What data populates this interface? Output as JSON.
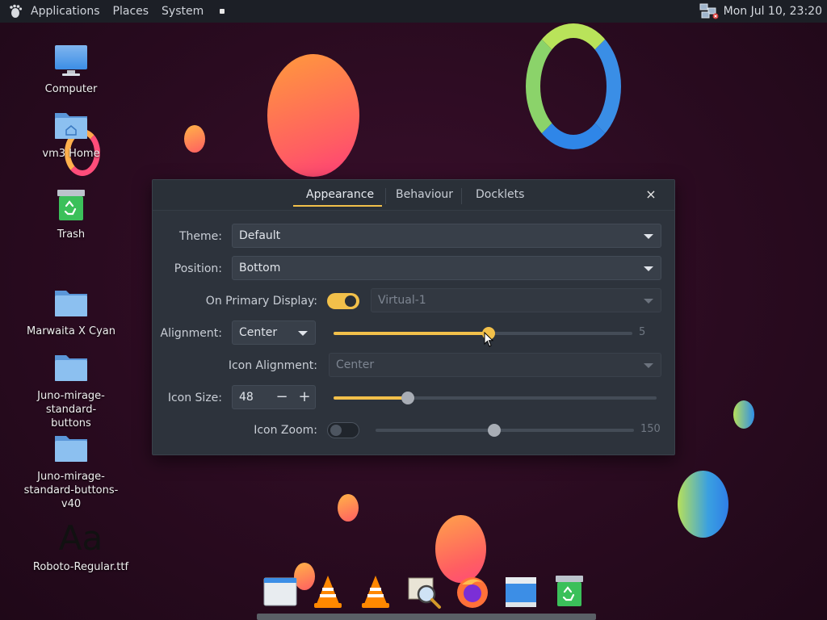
{
  "top_panel": {
    "menus": [
      "Applications",
      "Places",
      "System"
    ],
    "clock": "Mon Jul 10, 23:20"
  },
  "desktop": {
    "icons": [
      {
        "label": "Computer"
      },
      {
        "label": "vm3 Home"
      },
      {
        "label": "Trash"
      },
      {
        "label": "Marwaita X Cyan"
      },
      {
        "label": "Juno-mirage-standard-buttons"
      },
      {
        "label": "Juno-mirage-standard-buttons-v40"
      },
      {
        "label": "Roboto-Regular.ttf",
        "glyph": "Aa"
      }
    ]
  },
  "dialog": {
    "tabs": [
      "Appearance",
      "Behaviour",
      "Docklets"
    ],
    "active_tab": "Appearance",
    "close": "×",
    "theme": {
      "label": "Theme:",
      "value": "Default"
    },
    "position": {
      "label": "Position:",
      "value": "Bottom"
    },
    "primary_display": {
      "label": "On Primary Display:",
      "enabled": true,
      "value": "Virtual-1"
    },
    "alignment": {
      "label": "Alignment:",
      "value": "Center",
      "slider_fraction": 0.52,
      "slider_value": "5"
    },
    "icon_alignment": {
      "label": "Icon Alignment:",
      "value": "Center"
    },
    "icon_size": {
      "label": "Icon Size:",
      "value": "48",
      "minus": "−",
      "plus": "+",
      "slider_fraction": 0.23
    },
    "icon_zoom": {
      "label": "Icon Zoom:",
      "enabled": false,
      "slider_fraction": 0.46,
      "slider_value": "150"
    }
  },
  "dock": {
    "items": [
      "window-icon",
      "vlc-icon",
      "vlc-icon",
      "image-viewer-icon",
      "firefox-icon",
      "screen-icon",
      "trash-icon"
    ]
  },
  "colors": {
    "accent": "#f2c04a",
    "dialog_bg": "#2d333c",
    "panel_bg": "#1c1f26"
  }
}
